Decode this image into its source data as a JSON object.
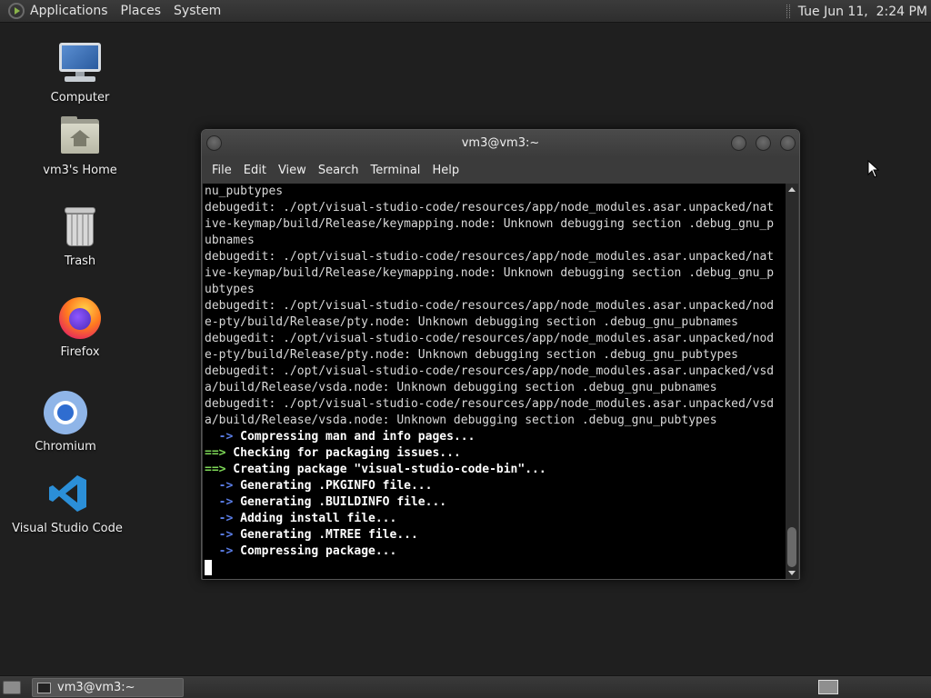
{
  "top_panel": {
    "menus": [
      "Applications",
      "Places",
      "System"
    ],
    "clock": "Tue Jun 11,  2:24 PM"
  },
  "desktop_icons": {
    "computer": "Computer",
    "home": "vm3's Home",
    "trash": "Trash",
    "firefox": "Firefox",
    "chromium": "Chromium",
    "vscode": "Visual Studio Code"
  },
  "terminal": {
    "title": "vm3@vm3:~",
    "menus": [
      "File",
      "Edit",
      "View",
      "Search",
      "Terminal",
      "Help"
    ],
    "plain_lines": [
      "nu_pubtypes",
      "debugedit: ./opt/visual-studio-code/resources/app/node_modules.asar.unpacked/nat",
      "ive-keymap/build/Release/keymapping.node: Unknown debugging section .debug_gnu_p",
      "ubnames",
      "debugedit: ./opt/visual-studio-code/resources/app/node_modules.asar.unpacked/nat",
      "ive-keymap/build/Release/keymapping.node: Unknown debugging section .debug_gnu_p",
      "ubtypes",
      "debugedit: ./opt/visual-studio-code/resources/app/node_modules.asar.unpacked/nod",
      "e-pty/build/Release/pty.node: Unknown debugging section .debug_gnu_pubnames",
      "debugedit: ./opt/visual-studio-code/resources/app/node_modules.asar.unpacked/nod",
      "e-pty/build/Release/pty.node: Unknown debugging section .debug_gnu_pubtypes",
      "debugedit: ./opt/visual-studio-code/resources/app/node_modules.asar.unpacked/vsd",
      "a/build/Release/vsda.node: Unknown debugging section .debug_gnu_pubnames",
      "debugedit: ./opt/visual-studio-code/resources/app/node_modules.asar.unpacked/vsd",
      "a/build/Release/vsda.node: Unknown debugging section .debug_gnu_pubtypes"
    ],
    "status_lines": [
      {
        "prefix": "  ->",
        "text": " Compressing man and info pages...",
        "color": "blue"
      },
      {
        "prefix": "==>",
        "text": " Checking for packaging issues...",
        "color": "green"
      },
      {
        "prefix": "==>",
        "text": " Creating package \"visual-studio-code-bin\"...",
        "color": "green"
      },
      {
        "prefix": "  ->",
        "text": " Generating .PKGINFO file...",
        "color": "blue"
      },
      {
        "prefix": "  ->",
        "text": " Generating .BUILDINFO file...",
        "color": "blue"
      },
      {
        "prefix": "  ->",
        "text": " Adding install file...",
        "color": "blue"
      },
      {
        "prefix": "  ->",
        "text": " Generating .MTREE file...",
        "color": "blue"
      },
      {
        "prefix": "  ->",
        "text": " Compressing package...",
        "color": "blue"
      }
    ]
  },
  "taskbar": {
    "window_label": "vm3@vm3:~"
  },
  "colors": {
    "arrow_blue": "#5b7ee8",
    "arrow_green": "#7ed957",
    "terminal_bg": "#000000",
    "desktop_bg": "#1f1f1f"
  }
}
